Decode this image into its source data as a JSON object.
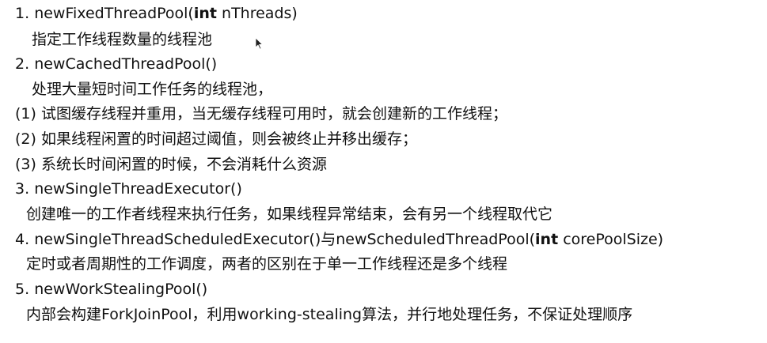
{
  "items": [
    {
      "number": "1.",
      "title_pre": "newFixedThreadPool(",
      "title_kw": "int",
      "title_post": " nThreads)",
      "desc": "指定工作线程数量的线程池"
    },
    {
      "number": "2.",
      "title": "newCachedThreadPool()",
      "desc": "处理大量短时间工作任务的线程池，",
      "points": [
        "(1) 试图缓存线程并重用，当无缓存线程可用时，就会创建新的工作线程；",
        "(2) 如果线程闲置的时间超过阈值，则会被终止并移出缓存；",
        "(3) 系统长时间闲置的时候，不会消耗什么资源"
      ]
    },
    {
      "number": "3.",
      "title": "newSingleThreadExecutor()",
      "desc": "创建唯一的工作者线程来执行任务，如果线程异常结束，会有另一个线程取代它"
    },
    {
      "number": "4.",
      "title_pre": "newSingleThreadScheduledExecutor()与newScheduledThreadPool(",
      "title_kw": "int",
      "title_post": " corePoolSize)",
      "desc": "定时或者周期性的工作调度，两者的区别在于单一工作线程还是多个线程"
    },
    {
      "number": "5.",
      "title": "newWorkStealingPool()",
      "desc": "内部会构建ForkJoinPool，利用working-stealing算法，并行地处理任务，不保证处理顺序"
    }
  ],
  "icons": {
    "cursor": "mouse-pointer-icon"
  }
}
